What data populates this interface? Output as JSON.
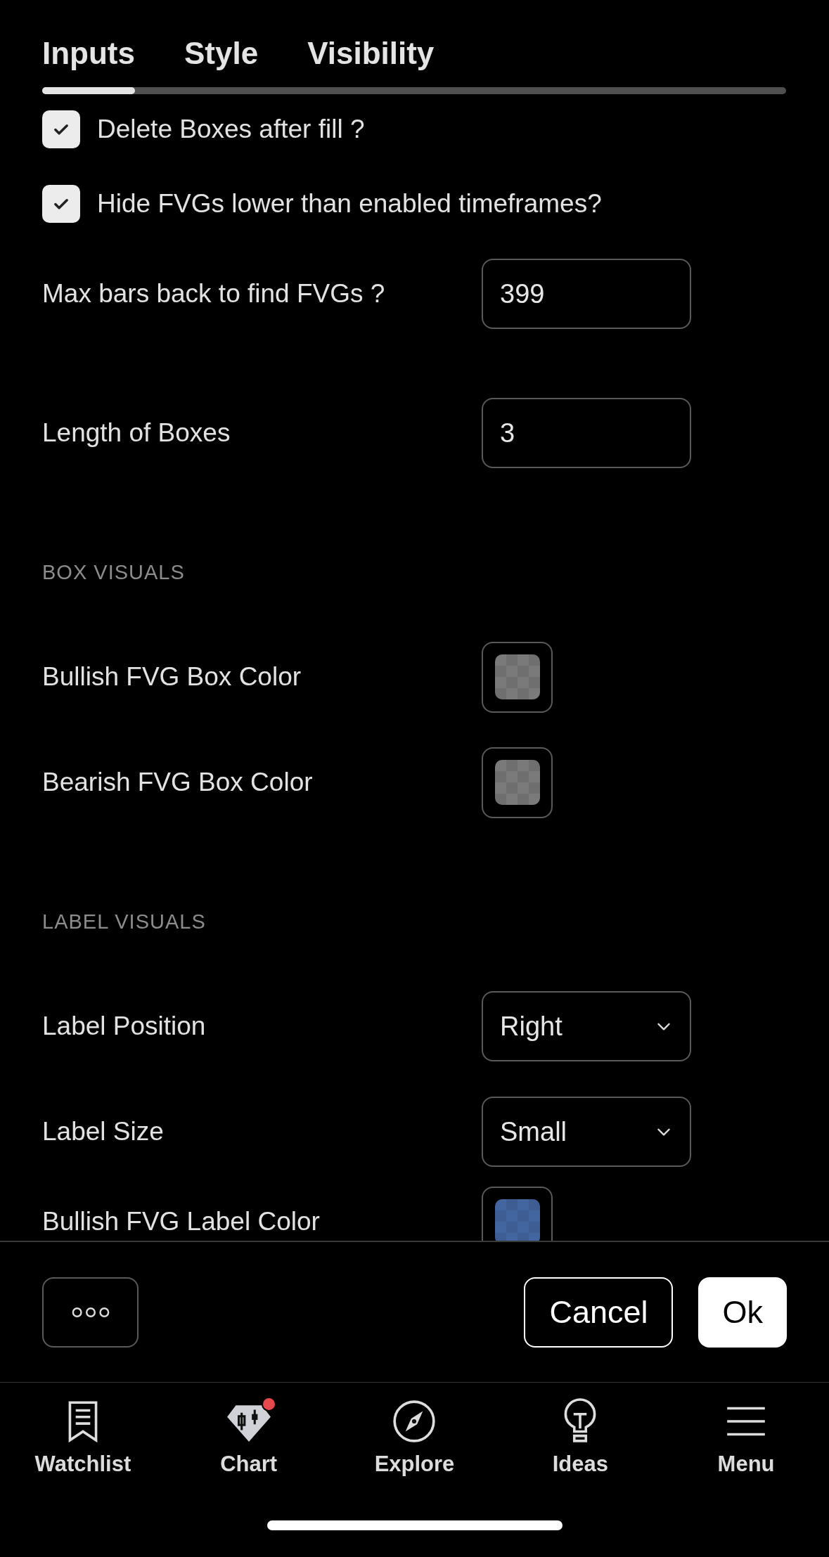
{
  "tabs": [
    {
      "label": "Inputs",
      "selected": true
    },
    {
      "label": "Style",
      "selected": false
    },
    {
      "label": "Visibility",
      "selected": false
    }
  ],
  "settings": [
    {
      "kind": "checkbox",
      "label": "Delete Boxes after fill ?",
      "checked": true
    },
    {
      "kind": "checkbox",
      "label": "Hide FVGs lower than enabled timeframes?",
      "checked": true
    },
    {
      "kind": "number",
      "label": "Max bars back to find FVGs ?",
      "value": "399"
    },
    {
      "kind": "number",
      "label": "Length of Boxes",
      "value": "3"
    },
    {
      "kind": "section",
      "label": "BOX VISUALS"
    },
    {
      "kind": "color",
      "label": "Bullish FVG Box Color",
      "color": "#7a7a7a"
    },
    {
      "kind": "color",
      "label": "Bearish FVG Box Color",
      "color": "#7a7a7a"
    },
    {
      "kind": "section",
      "label": "LABEL VISUALS"
    },
    {
      "kind": "select",
      "label": "Label Position",
      "value": "Right"
    },
    {
      "kind": "select",
      "label": "Label Size",
      "value": "Small"
    },
    {
      "kind": "color",
      "label": "Bullish FVG Label Color",
      "color": "#4466a0"
    }
  ],
  "footer": {
    "cancel": "Cancel",
    "ok": "Ok"
  },
  "nav": [
    {
      "kind": "watchlist",
      "label": "Watchlist",
      "notification": false
    },
    {
      "kind": "chart",
      "label": "Chart",
      "notification": true
    },
    {
      "kind": "explore",
      "label": "Explore",
      "notification": false
    },
    {
      "kind": "ideas",
      "label": "Ideas",
      "notification": false
    },
    {
      "kind": "menu",
      "label": "Menu",
      "notification": false
    }
  ]
}
